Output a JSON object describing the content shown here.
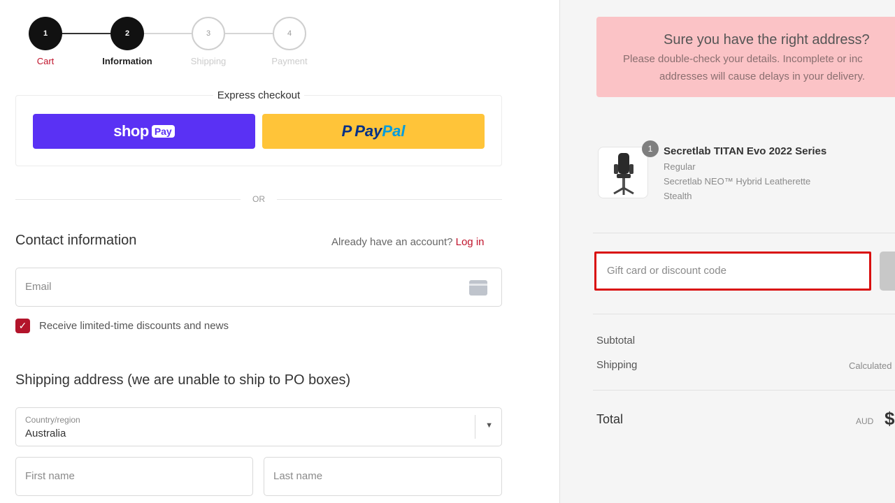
{
  "steps": [
    {
      "num": "1",
      "label": "Cart"
    },
    {
      "num": "2",
      "label": "Information"
    },
    {
      "num": "3",
      "label": "Shipping"
    },
    {
      "num": "4",
      "label": "Payment"
    }
  ],
  "express": {
    "title": "Express checkout",
    "shop_label": "shop",
    "shop_chip": "Pay",
    "paypal_part1": "Pay",
    "paypal_part2": "Pal"
  },
  "or_text": "OR",
  "contact": {
    "title": "Contact information",
    "account_prompt": "Already have an account?",
    "login_label": "Log in",
    "email_placeholder": "Email",
    "checkbox_label": "Receive limited-time discounts and news"
  },
  "shipping": {
    "title": "Shipping address (we are unable to ship to PO boxes)",
    "country_label": "Country/region",
    "country_value": "Australia",
    "first_name_placeholder": "First name",
    "last_name_placeholder": "Last name"
  },
  "alert": {
    "title": "Sure you have the right address?",
    "line1": "Please double-check your details. Incomplete or inc",
    "line2": "addresses will cause delays in your delivery."
  },
  "product": {
    "qty": "1",
    "name": "Secretlab TITAN Evo 2022 Series",
    "variant1": "Regular",
    "variant2": "Secretlab NEO™ Hybrid Leatherette",
    "variant3": "Stealth"
  },
  "discount_placeholder": "Gift card or discount code",
  "summary": {
    "subtotal_label": "Subtotal",
    "shipping_label": "Shipping",
    "shipping_value": "Calculated",
    "total_label": "Total",
    "currency": "AUD",
    "total_amount": "$"
  },
  "colors": {
    "brand_red": "#c0132b",
    "shop_pay": "#5a31f4",
    "paypal": "#ffc439",
    "alert_bg": "#fbc3c6"
  }
}
